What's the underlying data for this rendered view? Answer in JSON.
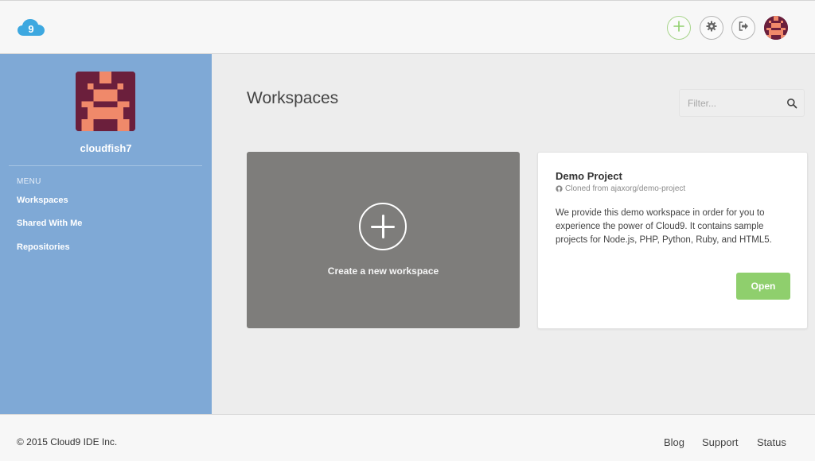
{
  "header": {
    "logo_text": "9",
    "buttons": [
      {
        "icon": "plus-icon"
      },
      {
        "icon": "gear-icon"
      },
      {
        "icon": "sign-out-icon"
      }
    ],
    "accent_color": "#8fcf6d"
  },
  "sidebar": {
    "username": "cloudfish7",
    "menu_label": "MENU",
    "items": [
      {
        "label": "Workspaces"
      },
      {
        "label": "Shared With Me"
      },
      {
        "label": "Repositories"
      }
    ],
    "background_color": "#7fa9d6"
  },
  "main": {
    "title": "Workspaces",
    "filter_placeholder": "Filter...",
    "create_card": {
      "label": "Create a new workspace"
    },
    "demo_card": {
      "title": "Demo Project",
      "source": "Cloned from ajaxorg/demo-project",
      "description": "We provide this demo workspace in order for you to experience the power of Cloud9. It contains sample projects for Node.js, PHP, Python, Ruby, and HTML5.",
      "open_label": "Open"
    }
  },
  "footer": {
    "copyright": "© 2015 Cloud9 IDE Inc.",
    "links": [
      {
        "label": "Blog"
      },
      {
        "label": "Support"
      },
      {
        "label": "Status"
      }
    ]
  }
}
